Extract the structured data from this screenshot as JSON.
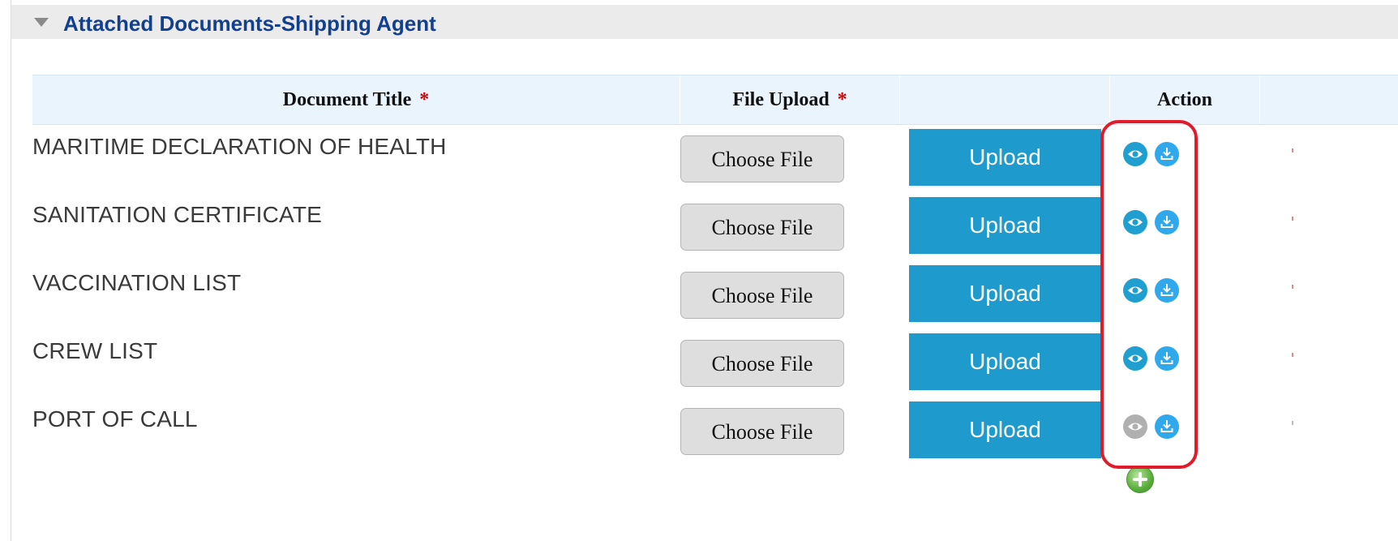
{
  "section": {
    "title": "Attached Documents-Shipping Agent",
    "caret_icon": "triangle-down-icon"
  },
  "table": {
    "headers": {
      "document_title": "Document Title",
      "file_upload": "File Upload",
      "blank": "",
      "action": "Action",
      "required_mark": "*"
    },
    "rows": [
      {
        "title": "MARITIME DECLARATION OF HEALTH",
        "choose_label": "Choose File",
        "upload_label": "Upload",
        "view_enabled": true
      },
      {
        "title": "SANITATION CERTIFICATE",
        "choose_label": "Choose File",
        "upload_label": "Upload",
        "view_enabled": true
      },
      {
        "title": "VACCINATION LIST",
        "choose_label": "Choose File",
        "upload_label": "Upload",
        "view_enabled": true
      },
      {
        "title": "CREW LIST",
        "choose_label": "Choose File",
        "upload_label": "Upload",
        "view_enabled": true
      },
      {
        "title": "PORT OF CALL",
        "choose_label": "Choose File",
        "upload_label": "Upload",
        "view_enabled": false
      }
    ]
  },
  "icons": {
    "view": "eye-icon",
    "download": "download-icon",
    "add": "add-circle-icon"
  },
  "colors": {
    "header_title": "#123f8e",
    "upload_button": "#1e9bcc",
    "view_icon": "#1f9fd0",
    "view_icon_disabled": "#b0b0b0",
    "download_icon": "#2fa9ec",
    "required": "#d40000",
    "highlight": "#e01b2a"
  }
}
